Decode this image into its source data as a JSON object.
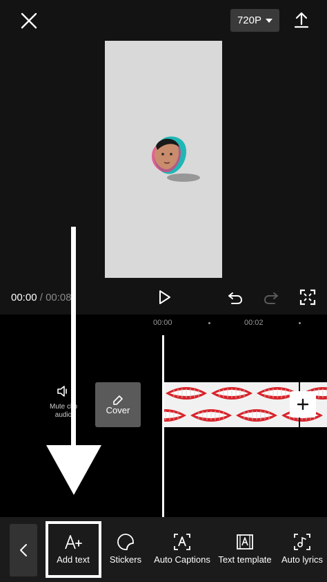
{
  "header": {
    "resolution_label": "720P",
    "close_icon": "close-icon",
    "export_icon": "upload-icon"
  },
  "playback": {
    "current_time": "00:00",
    "separator": " / ",
    "total_time": "00:08"
  },
  "timeline": {
    "ruler_labels": [
      "00:00",
      "00:02"
    ],
    "mute_label_line1": "Mute clip",
    "mute_label_line2": "audio",
    "cover_label": "Cover"
  },
  "toolbar": {
    "items": [
      {
        "label": "Add text",
        "icon": "add-text-icon"
      },
      {
        "label": "Stickers",
        "icon": "sticker-icon"
      },
      {
        "label": "Auto Captions",
        "icon": "auto-captions-icon"
      },
      {
        "label": "Text template",
        "icon": "text-template-icon"
      },
      {
        "label": "Auto lyrics",
        "icon": "auto-lyrics-icon"
      }
    ]
  },
  "colors": {
    "background": "#131313",
    "timeline_bg": "#000000",
    "toolbar_bg": "#1b1b1b",
    "preview_canvas": "#d9d9d9",
    "accent": "#ffffff"
  }
}
